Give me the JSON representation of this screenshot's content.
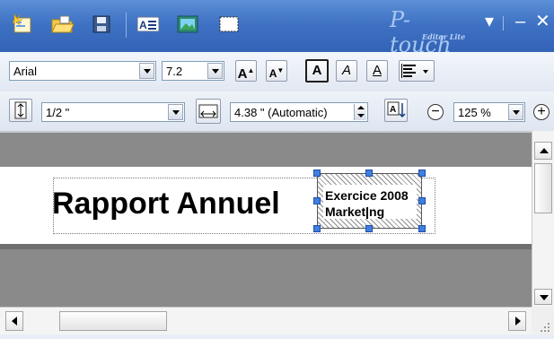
{
  "app": {
    "brand_main": "P-touch",
    "brand_sub": "Editor Lite"
  },
  "icons": {
    "new": "new-label-icon",
    "open": "open-folder-icon",
    "save": "save-disk-icon",
    "text": "insert-text-icon",
    "image": "insert-image-icon",
    "frame": "insert-frame-icon",
    "print": "printer-icon"
  },
  "toolbar": {
    "font_name": "Arial",
    "font_size": "7.2",
    "grow_font": "A",
    "shrink_font": "A",
    "bold": "A",
    "italic": "A",
    "underline": "A",
    "tape_width": "1/2 \"",
    "label_length": "4.38 \" (Automatic)",
    "zoom": "125 %"
  },
  "canvas": {
    "title_text": "Rapport Annuel",
    "side_line1": "Exercice 2008",
    "side_line2": "Marketing"
  },
  "colors": {
    "titlebar": "#3f72c4",
    "print_button": "#4f8fe0",
    "selection_handle": "#3f7fe0"
  }
}
